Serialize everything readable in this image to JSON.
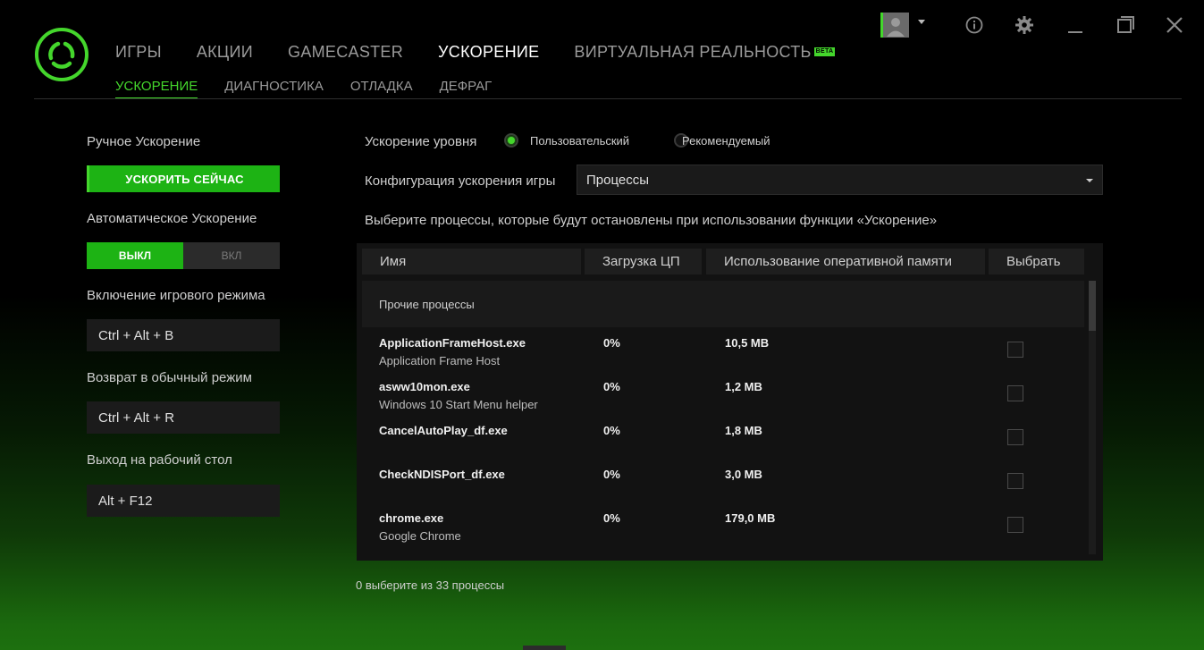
{
  "nav": {
    "tabs": [
      {
        "label": "ИГРЫ",
        "active": false
      },
      {
        "label": "АКЦИИ",
        "active": false
      },
      {
        "label": "GAMECASTER",
        "active": false
      },
      {
        "label": "УСКОРЕНИЕ",
        "active": true
      },
      {
        "label": "ВИРТУАЛЬНАЯ РЕАЛЬНОСТЬ",
        "active": false,
        "badge": "BETA"
      }
    ],
    "subtabs": [
      {
        "label": "УСКОРЕНИЕ",
        "active": true
      },
      {
        "label": "ДИАГНОСТИКА",
        "active": false
      },
      {
        "label": "ОТЛАДКА",
        "active": false
      },
      {
        "label": "ДЕФРАГ",
        "active": false
      }
    ]
  },
  "window_controls": {
    "icons": [
      "user-avatar-icon",
      "caret-down-icon",
      "info-icon",
      "gear-icon",
      "minimize-icon",
      "maximize-icon",
      "close-icon"
    ]
  },
  "left": {
    "manual_label": "Ручное Ускорение",
    "boost_now": "УСКОРИТЬ СЕЙЧАС",
    "auto_label": "Автоматическое Ускорение",
    "toggle_off": "ВЫКЛ",
    "toggle_on": "ВКЛ",
    "game_mode_label": "Включение игрового режима",
    "game_mode_keys": "Ctrl + Alt + B",
    "normal_mode_label": "Возврат в обычный режим",
    "normal_mode_keys": "Ctrl + Alt + R",
    "desktop_label": "Выход на рабочий стол",
    "desktop_keys": "Alt + F12"
  },
  "right": {
    "level_label": "Ускорение уровня",
    "radio_custom": "Пользовательский",
    "radio_recommended": "Рекомендуемый",
    "config_label": "Конфигурация ускорения игры",
    "config_value": "Процессы",
    "instruction": "Выберите процессы, которые будут остановлены при использовании функции «Ускорение»"
  },
  "table": {
    "headers": {
      "name": "Имя",
      "cpu": "Загрузка ЦП",
      "ram": "Использование оперативной памяти",
      "select": "Выбрать"
    },
    "group": "Прочие процессы",
    "rows": [
      {
        "name": "ApplicationFrameHost.exe",
        "desc": "Application Frame Host",
        "cpu": "0%",
        "ram": "10,5 MB"
      },
      {
        "name": "asww10mon.exe",
        "desc": "Windows 10 Start Menu helper",
        "cpu": "0%",
        "ram": "1,2 MB"
      },
      {
        "name": "CancelAutoPlay_df.exe",
        "desc": "",
        "cpu": "0%",
        "ram": "1,8 MB"
      },
      {
        "name": "CheckNDISPort_df.exe",
        "desc": "",
        "cpu": "0%",
        "ram": "3,0 MB"
      },
      {
        "name": "chrome.exe",
        "desc": "Google Chrome",
        "cpu": "0%",
        "ram": "179,0 MB"
      }
    ]
  },
  "footer": "0 выберите из 33 процессы",
  "colors": {
    "accent": "#44d62c",
    "button": "#1db314"
  }
}
